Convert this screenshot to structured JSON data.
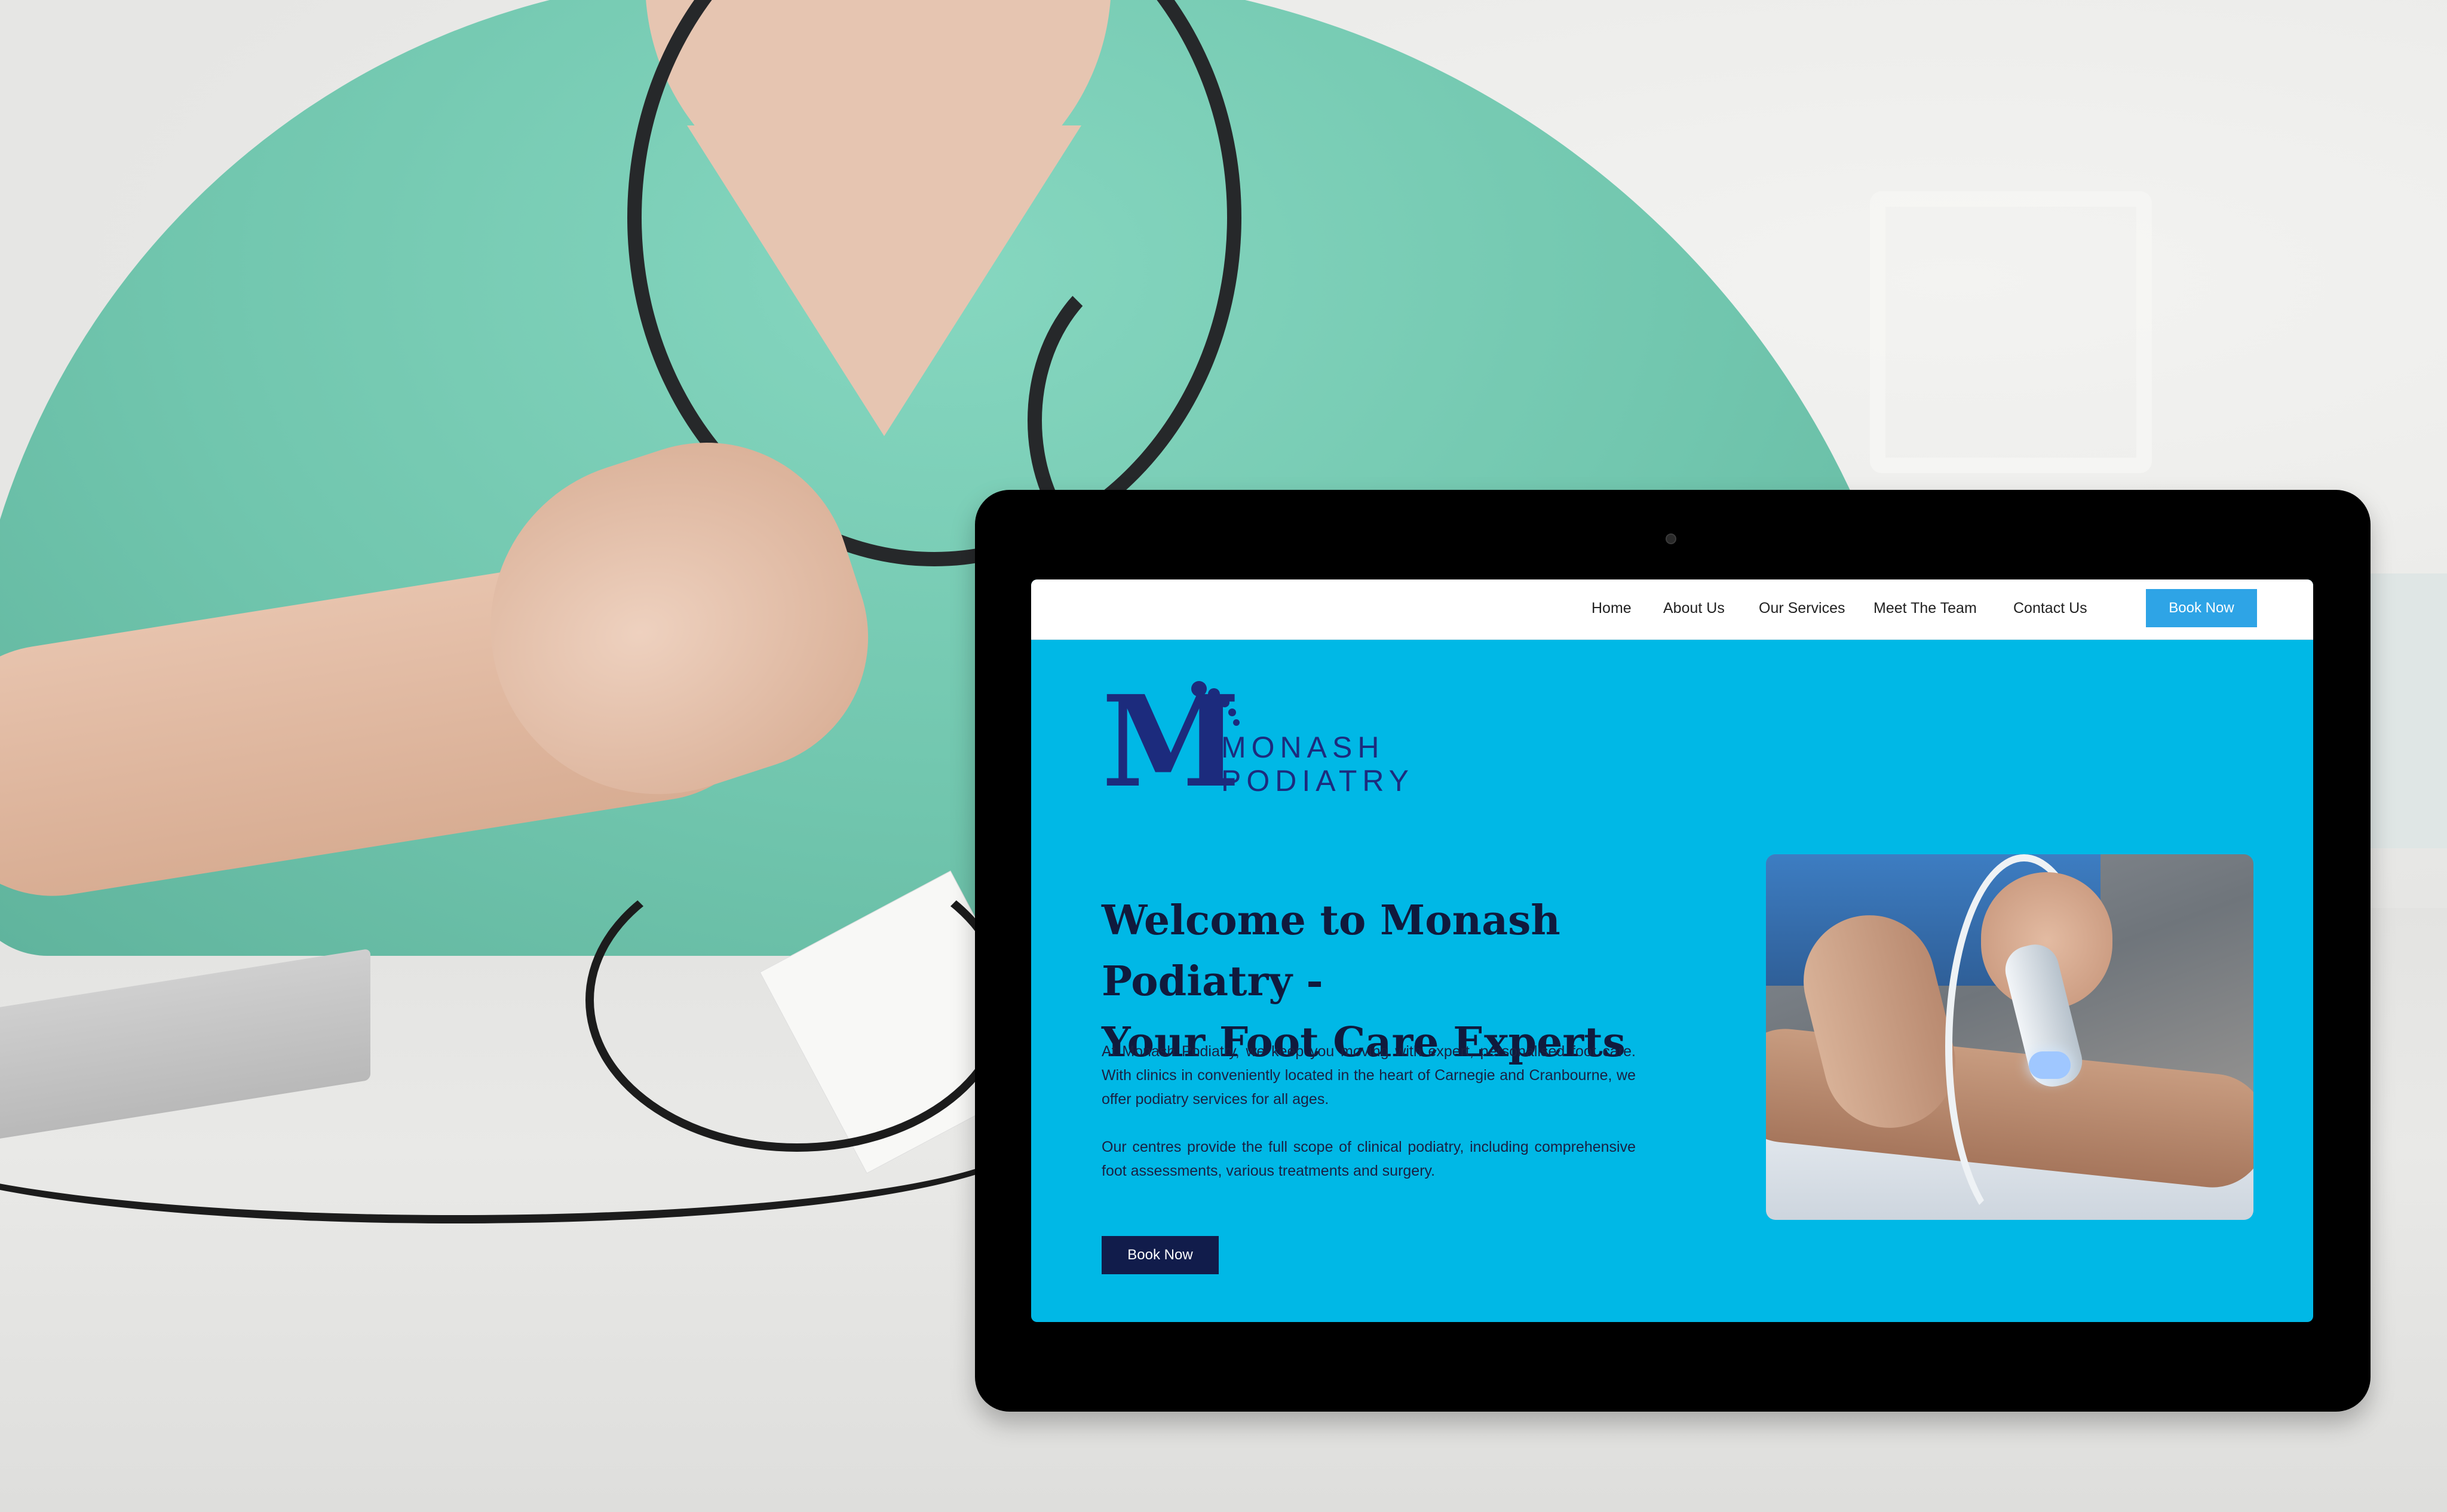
{
  "nav": {
    "links": [
      "Home",
      "About Us",
      "Our Services",
      "Meet The Team",
      "Contact Us"
    ],
    "cta": "Book Now"
  },
  "logo": {
    "line1": "MONASH",
    "line2": "PODIATRY"
  },
  "hero": {
    "headline_line1": "Welcome to Monash Podiatry -",
    "headline_line2": "Your Foot Care Experts",
    "paragraph1": "At Monash Podiatry, we keep you moving with expert, personalised foot care. With clinics in conveniently located in the heart of Carnegie and Cranbourne, we offer podiatry services for all ages.",
    "paragraph2": "Our centres provide the full scope of clinical podiatry, including comprehensive foot assessments, various treatments and surgery.",
    "cta": "Book Now"
  },
  "colors": {
    "hero_background": "#00b8e6",
    "brand_navy": "#1c2b7d",
    "nav_button": "#2ea4e6",
    "hero_button": "#111c4b"
  }
}
